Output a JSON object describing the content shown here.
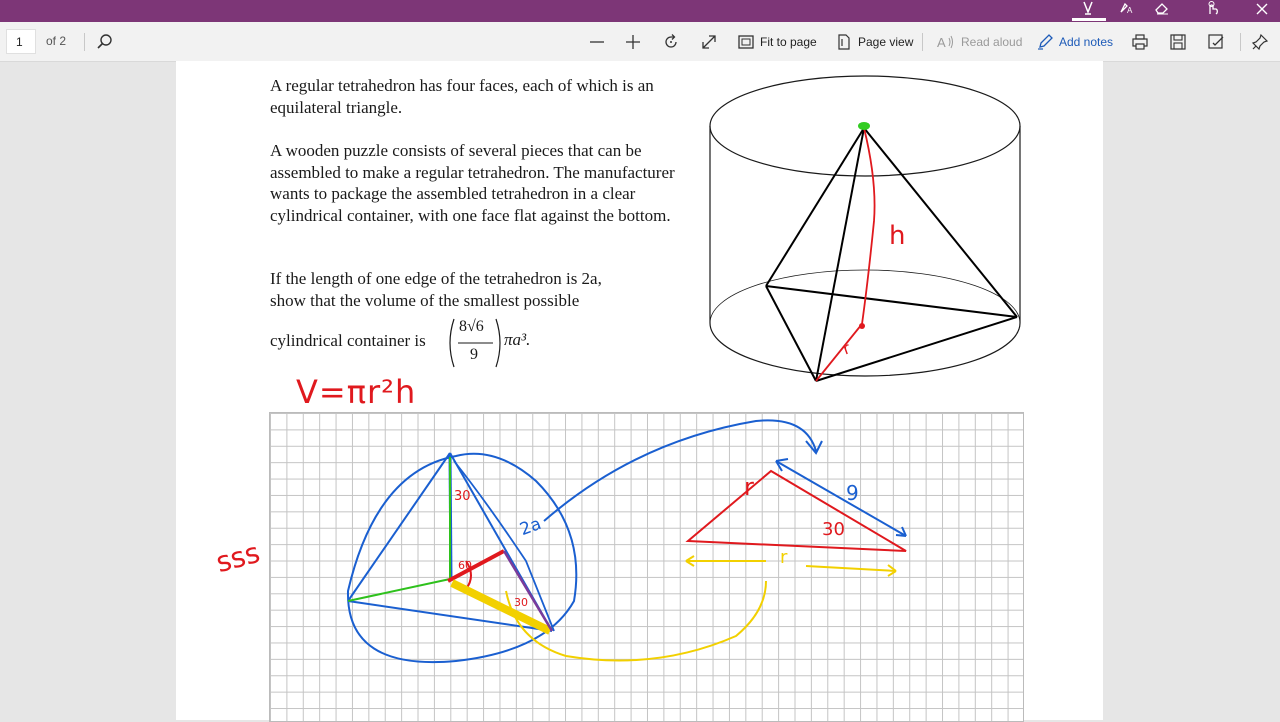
{
  "toolbar": {
    "page_number": "1",
    "of_pages": "of 2",
    "fit_to_page": "Fit to page",
    "page_view": "Page view",
    "read_aloud": "Read aloud",
    "add_notes": "Add notes"
  },
  "document": {
    "paragraph1": "A regular tetrahedron has four faces, each of which is an equilateral triangle.",
    "paragraph2": "A wooden puzzle consists of several pieces that can be assembled to make a regular tetrahedron.  The manufacturer wants to package the assembled tetrahedron in a clear cylindrical container, with one face flat against the bottom.",
    "paragraph3_a": "If the length of one edge of the tetrahedron is 2a,",
    "paragraph3_b": "show that the volume of the smallest possible",
    "paragraph3_c": "cylindrical container is",
    "frac_num": "8√6",
    "frac_den": "9",
    "frac_tail": "πa³."
  },
  "annotations": {
    "formula": "V=πr²h",
    "h_label": "h",
    "r_label": "r",
    "sss": "sss",
    "angle_30": "30",
    "angle_30b": "30",
    "angle_60": "60",
    "side_2a": "2a",
    "tri_r": "r",
    "tri_9": "9",
    "tri_30": "30",
    "r_bottom": "r"
  },
  "colors": {
    "titlebar": "#7d3677",
    "ink_red": "#e0191e",
    "ink_blue": "#1a5fd0",
    "ink_green": "#2ec11c",
    "ink_yellow": "#f2d000",
    "ink_purple": "#7a3b9a"
  }
}
